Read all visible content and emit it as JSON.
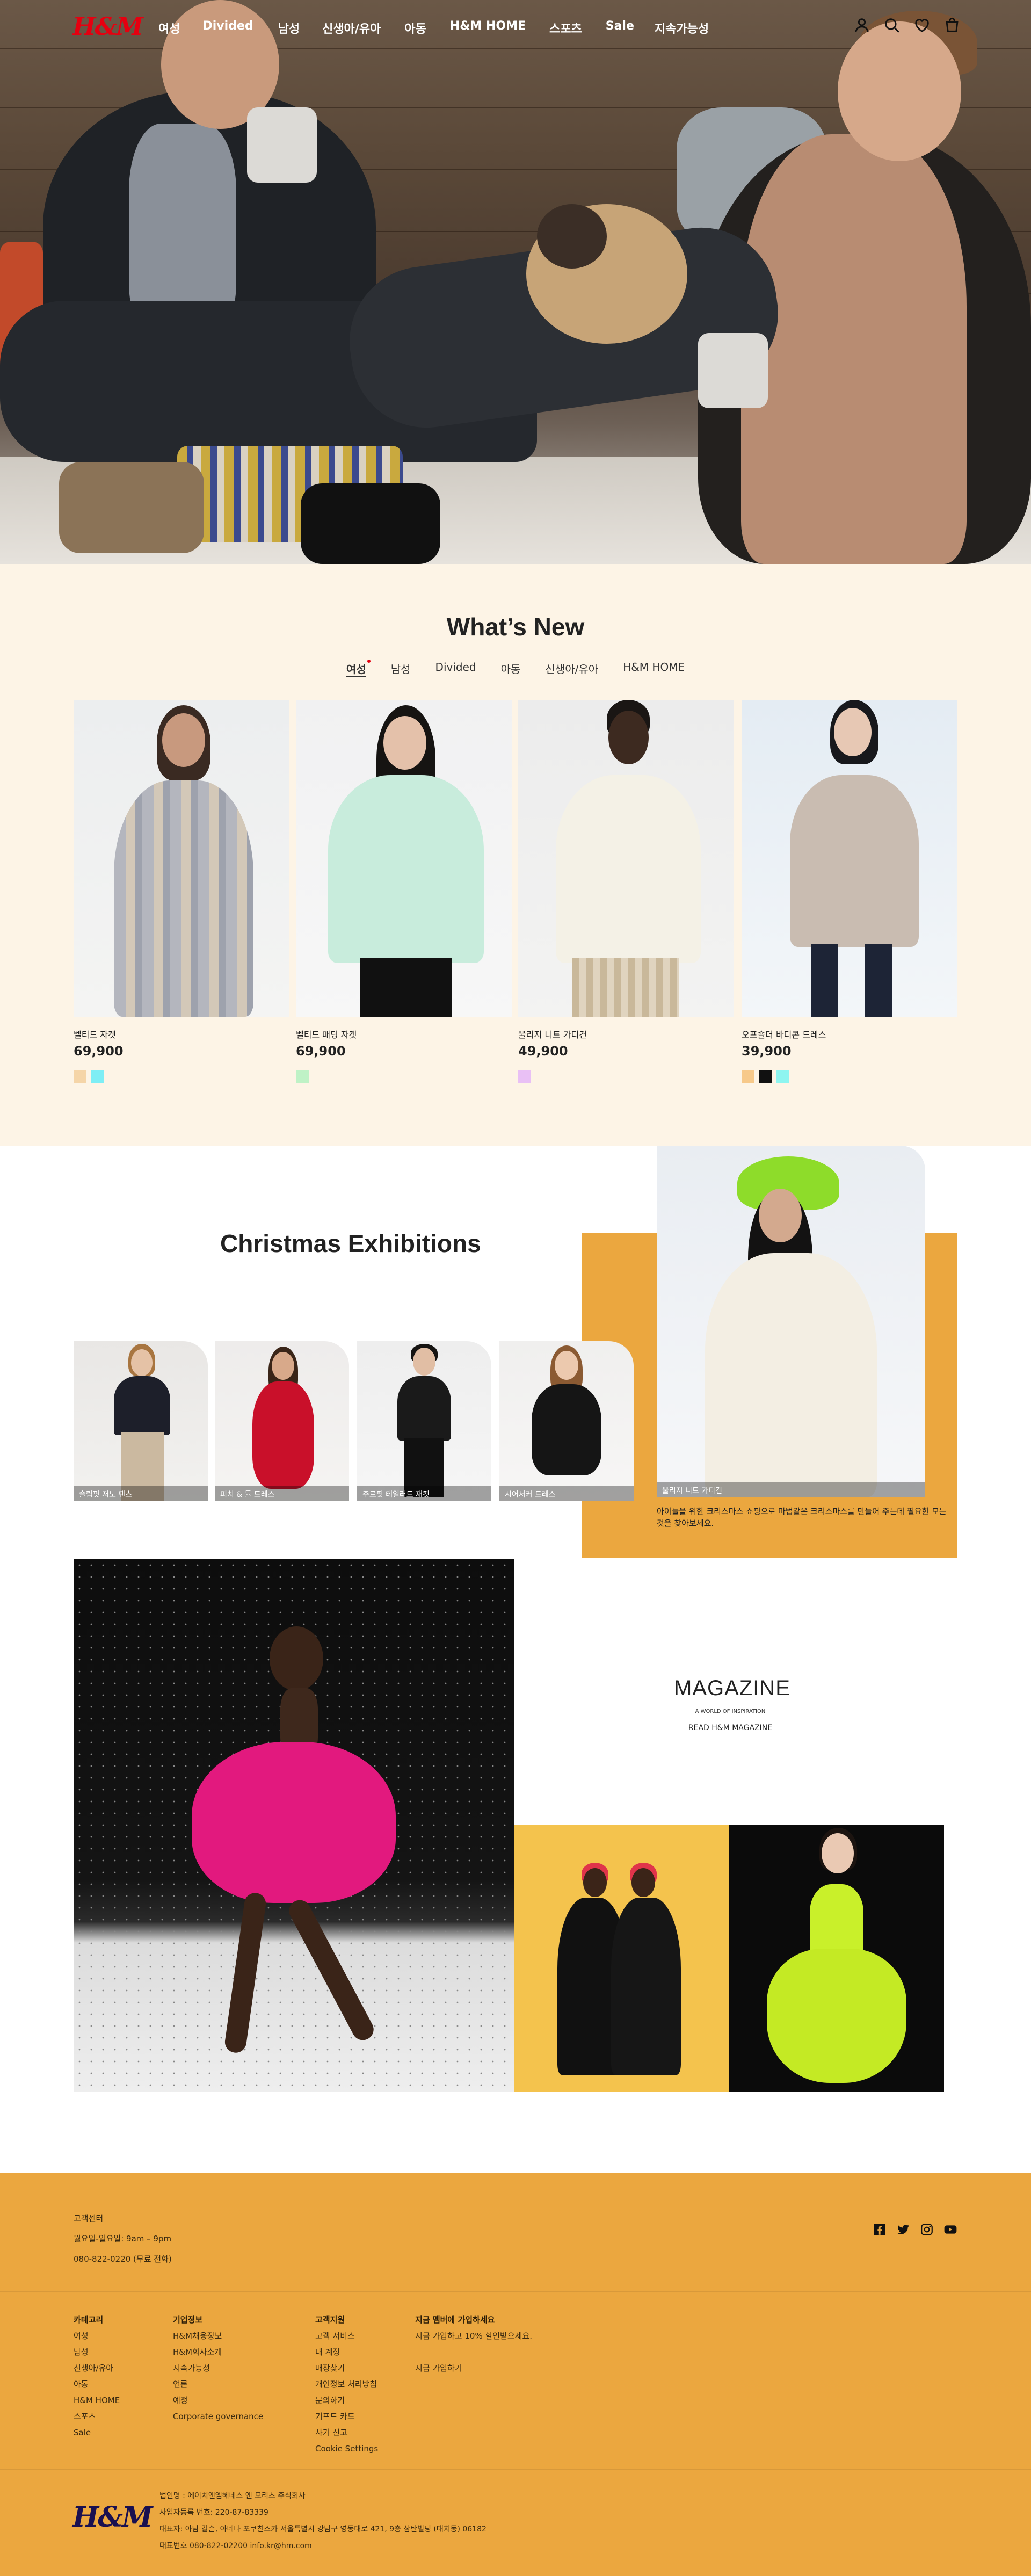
{
  "nav": {
    "logo": "H&M",
    "links": [
      "여성",
      "Divided",
      "남성",
      "신생아/유아",
      "아동",
      "H&M HOME",
      "스포츠",
      "Sale",
      "지속가능성"
    ],
    "icons": [
      "user-icon",
      "search-icon",
      "heart-icon",
      "cart-icon"
    ]
  },
  "whats_new": {
    "title": "What’s New",
    "tabs": [
      "여성",
      "남성",
      "Divided",
      "아동",
      "신생아/유아",
      "H&M HOME"
    ],
    "active_tab": "여성",
    "products": [
      {
        "name": "벨티드 자켓",
        "price": "69,900",
        "swatches": [
          "#f5d5a8",
          "#7eeef5"
        ]
      },
      {
        "name": "벨티드 패딩 자켓",
        "price": "69,900",
        "swatches": [
          "#bff2c6"
        ]
      },
      {
        "name": "울리지 니트 가디건",
        "price": "49,900",
        "swatches": [
          "#e9c0f5"
        ]
      },
      {
        "name": "오프숄더 바디콘 드레스",
        "price": "39,900",
        "swatches": [
          "#f7c98a",
          "#111111",
          "#8ef5f0"
        ]
      }
    ]
  },
  "christmas": {
    "title": "Christmas Exhibitions",
    "cards": [
      "슬림핏 저노 팬츠",
      "피치 & 튤 드레스",
      "주르핏 테일러드 재킷",
      "시어서커 드레스"
    ],
    "feature_label": "울리지 니트 가디건",
    "description": "아이들을 위한 크리스마스 쇼핑으로 마법같은 크리스마스를 만들어 주는데 필요한 모든 것을 찾아보세요."
  },
  "magazine": {
    "title": "MAGAZINE",
    "subtitle": "A WORLD OF INSPIRATION",
    "link": "READ H&M MAGAZINE"
  },
  "footer": {
    "customer_service": [
      "고객센터",
      "월요일-일요일: 9am – 9pm",
      "080-822-0220 (무료 전화)"
    ],
    "social_icons": [
      "facebook-icon",
      "twitter-icon",
      "instagram-icon",
      "youtube-icon"
    ],
    "columns": [
      {
        "heading": "카테고리",
        "items": [
          "여성",
          "남성",
          "신생아/유아",
          "아동",
          "H&M HOME",
          "스포츠",
          "Sale"
        ]
      },
      {
        "heading": "기업정보",
        "items": [
          "H&M채용정보",
          "H&M회사소개",
          "지속가능성",
          "언론",
          "예정",
          "Corporate governance"
        ]
      },
      {
        "heading": "고객지원",
        "items": [
          "고객 서비스",
          "내 계정",
          "매장찾기",
          "개인정보 처리방침",
          "문의하기",
          "기프트 카드",
          "사기 신고",
          "Cookie Settings"
        ]
      },
      {
        "heading": "지금 멤버에 가입하세요",
        "items": [
          "지금 가입하고 10% 할인받으세요.",
          "지금 가입하기"
        ]
      }
    ],
    "logo": "H&M",
    "company": [
      "법인명 : 에이치앤엠헤네스 앤 모리츠 주식회사",
      "사업자등록 번호: 220-87-83339",
      "대표자: 아담 칼슨, 아네타 포쿠친스카 서울특별시 강남구 영동대로 421, 9층 삼탄빌딩 (대치동) 06182",
      "대표번호 080-822-02200 info.kr@hm.com"
    ]
  }
}
